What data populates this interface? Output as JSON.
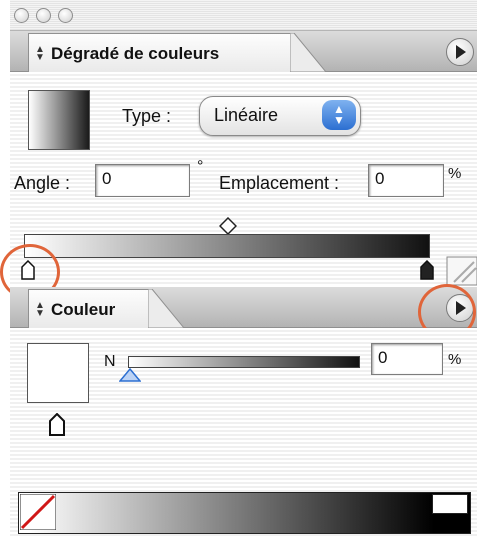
{
  "window": {
    "title": ""
  },
  "gradient_panel": {
    "tab_label": "Dégradé de couleurs",
    "type_label": "Type :",
    "type_value": "Linéaire",
    "angle_label": "Angle :",
    "angle_value": "0",
    "degree_symbol": "°",
    "location_label": "Emplacement :",
    "location_value": "0",
    "location_unit": "%"
  },
  "color_panel": {
    "tab_label": "Couleur",
    "channel_label": "N",
    "channel_value": "0",
    "channel_unit": "%",
    "slider_value_percent": 0
  },
  "icons": [
    "close-light",
    "minimize-light",
    "zoom-light",
    "sort-arrows-icon",
    "panel-menu-icon",
    "diamond-midpoint-icon",
    "gradient-stop-icon",
    "none-swatch-icon",
    "select-arrows-icon"
  ],
  "colors": {
    "highlight": "#e0653a",
    "accent_blue": "#2c6fd1"
  }
}
